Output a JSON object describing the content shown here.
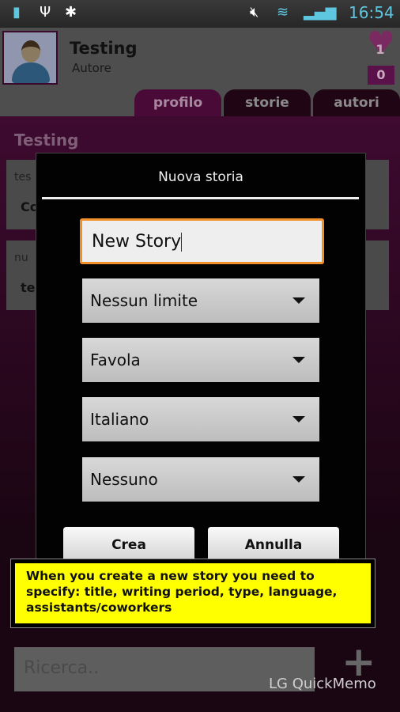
{
  "status_bar": {
    "time": "16:54",
    "icons": [
      "battery-usb-icon",
      "usb-icon",
      "android-debug-icon",
      "muted-icon",
      "wifi-icon",
      "signal-icon",
      "battery-charging-icon"
    ]
  },
  "profile": {
    "name": "Testing",
    "role": "Autore",
    "likes": "1",
    "stories": "0"
  },
  "tabs": [
    {
      "label": "profilo",
      "active": true
    },
    {
      "label": "storie"
    },
    {
      "label": "autori"
    }
  ],
  "section_title": "Testing",
  "list": [
    {
      "line1": "tes",
      "line2": "Co"
    },
    {
      "line1": "nu",
      "line2": "te"
    }
  ],
  "dialog": {
    "title": "Nuova storia",
    "title_value": "New Story",
    "selects": [
      {
        "value": "Nessun limite"
      },
      {
        "value": "Favola"
      },
      {
        "value": "Italiano"
      },
      {
        "value": "Nessuno"
      }
    ],
    "create": "Crea",
    "cancel": "Annulla"
  },
  "tooltip": "When you create a new story you need to specify: title, writing period, type, language, assistants/coworkers",
  "search": {
    "placeholder": "Ricerca.."
  },
  "watermark": "LG QuickMemo",
  "colors": {
    "accent": "#4a0a38",
    "focus": "#f0902a",
    "tooltip": "#ffff00"
  }
}
